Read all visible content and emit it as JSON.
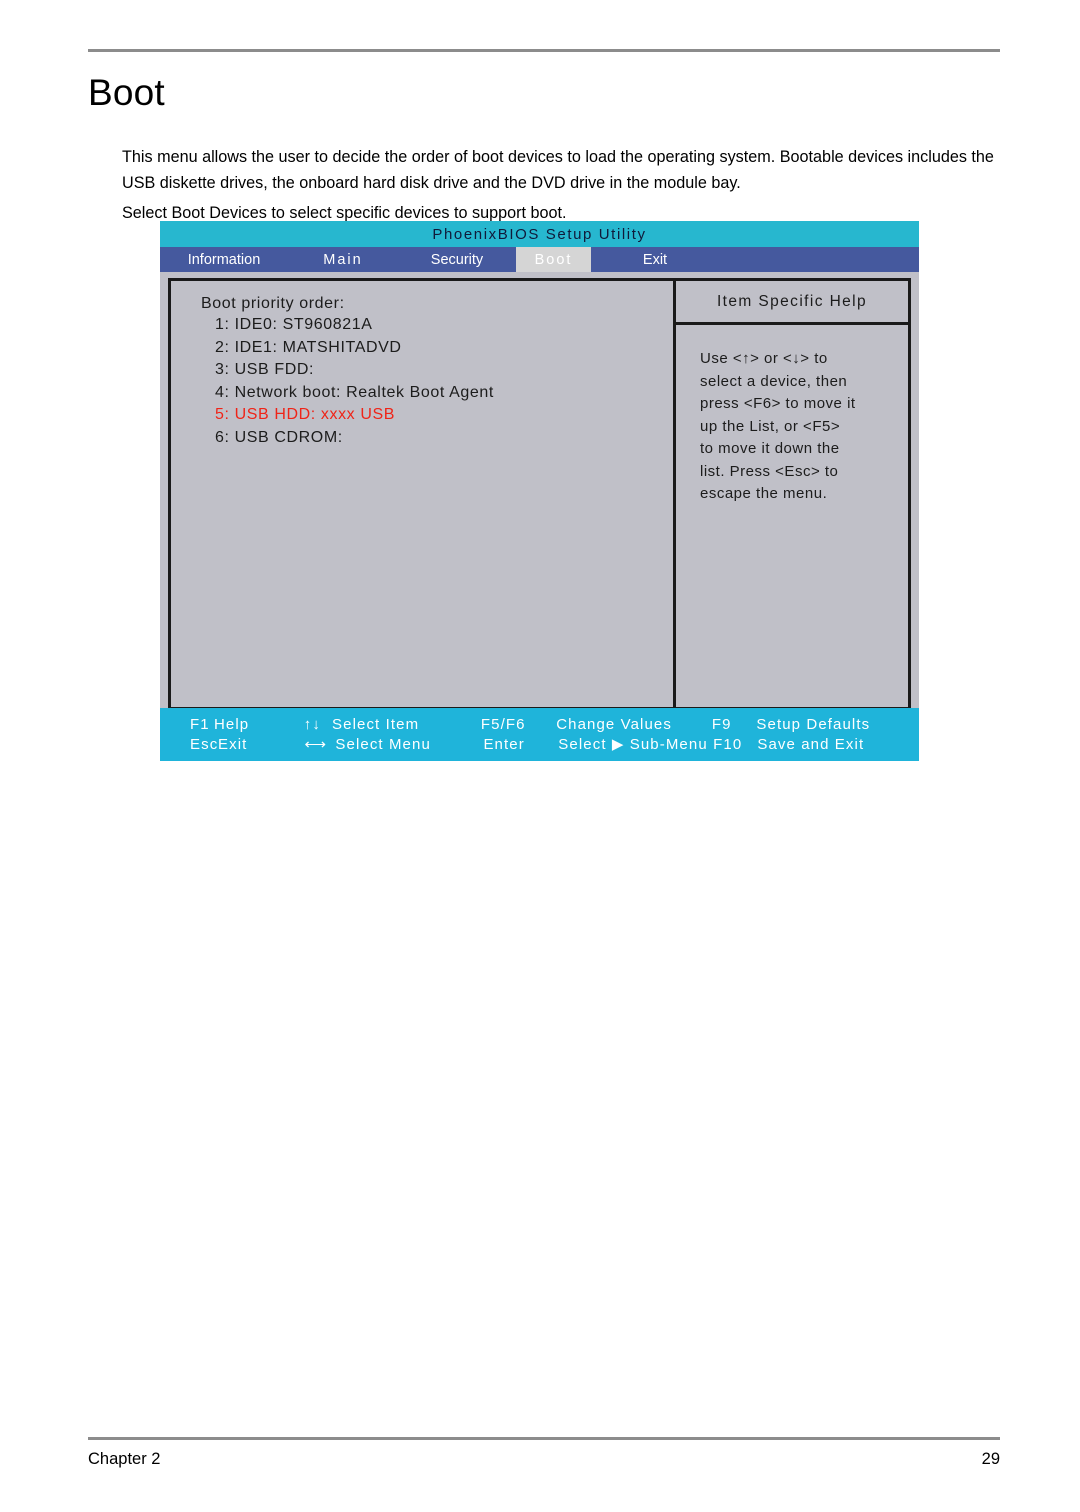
{
  "document": {
    "title": "Boot",
    "paragraphs": [
      "This menu allows the user to decide the order of boot devices to load the operating system. Bootable devices includes the USB diskette drives, the onboard hard disk drive and the DVD drive in the module bay.",
      "Select Boot Devices to select specific devices to support boot."
    ],
    "footer": {
      "chapter": "Chapter 2",
      "page_number": "29"
    }
  },
  "bios": {
    "title": "PhoenixBIOS Setup Utility",
    "tabs": [
      {
        "label": "Information",
        "active": false
      },
      {
        "label": "Main",
        "active": false
      },
      {
        "label": "Security",
        "active": false
      },
      {
        "label": "Boot",
        "active": true
      },
      {
        "label": "Exit",
        "active": false
      }
    ],
    "boot_panel": {
      "heading": "Boot priority order:",
      "items": [
        {
          "label": "1: IDE0: ST960821A",
          "highlighted": false
        },
        {
          "label": "2: IDE1: MATSHITADVD",
          "highlighted": false
        },
        {
          "label": "3: USB FDD:",
          "highlighted": false
        },
        {
          "label": "4: Network boot: Realtek Boot Agent",
          "highlighted": false
        },
        {
          "label": "5: USB HDD: xxxx USB",
          "highlighted": true
        },
        {
          "label": "6: USB CDROM:",
          "highlighted": false
        }
      ]
    },
    "help_panel": {
      "title": "Item Specific Help",
      "lines": [
        "Use <↑> or <↓> to",
        "select a device, then",
        "press <F6> to move it",
        "up the List, or <F5>",
        "to move it down the",
        "list. Press <Esc> to",
        "escape the menu."
      ]
    },
    "status_bar": {
      "row1": {
        "key1": "F1",
        "val1": "Help",
        "key2": "↑↓",
        "val2": "Select  Item",
        "key3": "F5/F6",
        "val3": "Change  Values",
        "key4": "F9",
        "val4": "Setup  Defaults"
      },
      "row2": {
        "key1": "Esc",
        "val1": "Exit",
        "key2": "⟷",
        "val2": "Select  Menu",
        "key3": "Enter",
        "val3": "Select  ▶  Sub-Menu",
        "key4": "F10",
        "val4": "Save  and  Exit"
      }
    },
    "colors": {
      "title_bar": "#27b7cf",
      "tab_bar": "#45599e",
      "active_tab": "#d5d5d5",
      "panel_background": "#c0c0c8",
      "status_bar": "#1fb4da",
      "highlight_text": "#ef2418"
    }
  }
}
